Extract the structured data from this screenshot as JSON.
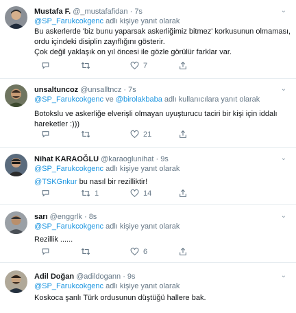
{
  "colors": {
    "link": "#1b95e0",
    "muted": "#657786",
    "divider": "#e6ecf0"
  },
  "tweets": [
    {
      "name": "Mustafa F.",
      "handle": "@_mustafafidan",
      "dot": "·",
      "time": "7s",
      "reply_mentions": [
        "@SP_Farukcokgenc"
      ],
      "reply_sep": "",
      "reply_suffix": " adlı kişiye yanıt olarak",
      "text_lines": [
        "Bu askerlerde 'biz bunu yaparsak askerliğimiz bitmez' korkusunun olmaması,",
        "ordu içindeki disiplin zayıflığını gösterir.",
        "Çok değil yaklaşık on yıl öncesi ile gözle görülür farklar var."
      ],
      "text_mentions": [],
      "counts": {
        "reply": "",
        "retweet": "",
        "like": "7"
      },
      "icons": [
        "reply-icon",
        "retweet-icon",
        "like-icon",
        "share-icon"
      ]
    },
    {
      "name": "unsaltuncoz",
      "handle": "@unsalltncz",
      "dot": "·",
      "time": "7s",
      "reply_mentions": [
        "@SP_Farukcokgenc",
        "@birolakbaba"
      ],
      "reply_sep": " ve ",
      "reply_suffix": " adlı kullanıcılara yanıt olarak",
      "text_lines": [
        "Botokslu ve askerliğe elverişli olmayan uyuşturucu taciri bir kişi için iddalı",
        "hareketler :)))"
      ],
      "text_mentions": [],
      "counts": {
        "reply": "",
        "retweet": "",
        "like": "21"
      },
      "icons": [
        "reply-icon",
        "retweet-icon",
        "like-icon",
        "share-icon"
      ]
    },
    {
      "name": "Nihat KARAOĞLU",
      "handle": "@karaoglunihat",
      "dot": "·",
      "time": "9s",
      "reply_mentions": [
        "@SP_Farukcokgenc"
      ],
      "reply_sep": "",
      "reply_suffix": " adlı kişiye yanıt olarak",
      "text_lines": [
        " bu nasıl bir rezilliktir!"
      ],
      "text_mentions": [
        "@TSKGnkur"
      ],
      "counts": {
        "reply": "",
        "retweet": "1",
        "like": "14"
      },
      "icons": [
        "reply-icon",
        "retweet-icon",
        "like-icon",
        "share-icon"
      ]
    },
    {
      "name": "sarı",
      "handle": "@enggrlk",
      "dot": "·",
      "time": "8s",
      "reply_mentions": [
        "@SP_Farukcokgenc"
      ],
      "reply_sep": "",
      "reply_suffix": " adlı kişiye yanıt olarak",
      "text_lines": [
        "Rezillik ......"
      ],
      "text_mentions": [],
      "counts": {
        "reply": "",
        "retweet": "",
        "like": "6"
      },
      "icons": [
        "reply-icon",
        "retweet-icon",
        "like-icon",
        "share-icon"
      ]
    },
    {
      "name": "Adil Doğan",
      "handle": "@adildogann",
      "dot": "·",
      "time": "9s",
      "reply_mentions": [
        "@SP_Farukcokgenc"
      ],
      "reply_sep": "",
      "reply_suffix": " adlı kişiye yanıt olarak",
      "text_lines": [
        "Koskoca şanlı Türk ordusunun düştüğü hallere bak."
      ],
      "text_mentions": [],
      "counts": {
        "reply": "",
        "retweet": "",
        "like": ""
      },
      "icons": []
    }
  ]
}
